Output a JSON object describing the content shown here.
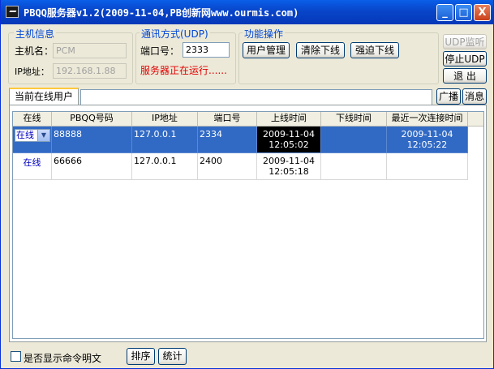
{
  "window": {
    "title": "PBQQ服务器v1.2(2009-11-04,PB创新网www.ourmis.com)"
  },
  "titlebar_buttons": {
    "minimize": "_",
    "maximize": "□",
    "close": "X"
  },
  "host_info": {
    "group_title": "主机信息",
    "hostname_label": "主机名：",
    "hostname_value": "PCM",
    "ip_label": "IP地址：",
    "ip_value": "192.168.1.88"
  },
  "comm": {
    "group_title": "通讯方式(UDP)",
    "port_label": "端口号：",
    "port_value": "2333",
    "status": "服务器正在运行......"
  },
  "functions": {
    "group_title": "功能操作",
    "user_mgmt": "用户管理",
    "clear_offline": "清除下线",
    "force_offline": "强迫下线"
  },
  "udp": {
    "listen": "UDP监听",
    "stop": "停止UDP",
    "exit": "退 出"
  },
  "tabs": {
    "online_users": "当前在线用户"
  },
  "message_input": "",
  "actions": {
    "broadcast": "广播",
    "message": "消息",
    "sort": "排序",
    "stats": "统计"
  },
  "table": {
    "columns": [
      "在线",
      "PBQQ号码",
      "IP地址",
      "端口号",
      "上线时间",
      "下线时间",
      "最近一次连接时间"
    ],
    "rows": [
      {
        "online": "在线",
        "qq": "88888",
        "ip": "127.0.0.1",
        "port": "2334",
        "login_date": "2009-11-04",
        "login_time": "12:05:02",
        "logout": "",
        "last_date": "2009-11-04",
        "last_time": "12:05:22"
      },
      {
        "online": "在线",
        "qq": "66666",
        "ip": "127.0.0.1",
        "port": "2400",
        "login_date": "2009-11-04",
        "login_time": "12:05:18",
        "logout": "",
        "last_date": "",
        "last_time": ""
      }
    ]
  },
  "footer": {
    "show_cmd_label": "是否显示命令明文"
  },
  "colors": {
    "titlebar": "#0845C9",
    "window_bg": "#ECE9D8",
    "group_title": "#0046D5",
    "status_red": "#E00000",
    "selection": "#316AC5"
  }
}
